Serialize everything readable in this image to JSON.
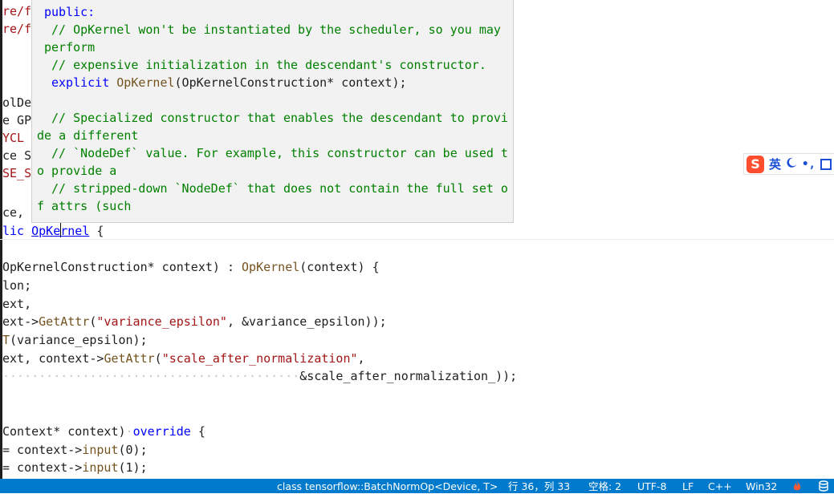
{
  "editor": {
    "line_fragments": [
      "re/f",
      "re/f",
      "olDe",
      "e GP",
      "YCL",
      "ce S",
      "SE_S",
      "ce,"
    ],
    "class_line": {
      "prefix": "lic ",
      "type_name": "OpKernel",
      "suffix": " {"
    },
    "ctor_line": {
      "params": "OpKernelConstruction* context)",
      "colon": " : ",
      "base": "OpKernel",
      "args": "(context) {"
    },
    "line_lon": "lon;",
    "line_ext": "ext,",
    "getattr_line1": {
      "prefix": "ext->",
      "fn": "GetAttr",
      "open": "(",
      "str": "\"variance_epsilon\"",
      "rest": ", &variance_epsilon));"
    },
    "line_T": {
      "fn": "T",
      "rest": "(variance_epsilon);"
    },
    "getattr_line2": {
      "prefix": "ext, context->",
      "fn": "GetAttr",
      "open": "(",
      "str": "\"scale_after_normalization\"",
      "rest": ","
    },
    "indent_line": "&scale_after_normalization_));",
    "compute_line": {
      "params": "Context* context)",
      "kw": "override",
      "rest": " {"
    },
    "input0_line": {
      "prefix": "= context->",
      "fn": "input",
      "rest": "(0);"
    },
    "input1_line": {
      "prefix": "= context->",
      "fn": "input",
      "rest": "(1);"
    }
  },
  "tooltip": {
    "line1_kw": "public:",
    "line2": "// OpKernel won't be instantiated by the scheduler, so you may",
    "line3": "perform",
    "line4": "// expensive initialization in the descendant's constructor.",
    "line5_kw": "explicit",
    "line5_fn": "OpKernel",
    "line5_rest": "(OpKernelConstruction* context);",
    "line6": "// Specialized constructor that enables the descendant to provi",
    "line7": "de a different",
    "line8": "// `NodeDef` value. For example, this constructor can be used t",
    "line9": "o provide a",
    "line10": "// stripped-down `NodeDef` that does not contain the full set o",
    "line11": "f attrs (such"
  },
  "ime": {
    "logo": "S",
    "mode": "英",
    "moon_icon": "moon-icon",
    "punct": "•,",
    "grid_icon": "grid-icon"
  },
  "statusbar": {
    "scope": "class tensorflow::BatchNormOp<Device, T>",
    "position": "行 36，列 33",
    "indent": "空格: 2",
    "encoding": "UTF-8",
    "eol": "LF",
    "language": "C++",
    "platform": "Win32",
    "bg_color": "#007acc"
  }
}
